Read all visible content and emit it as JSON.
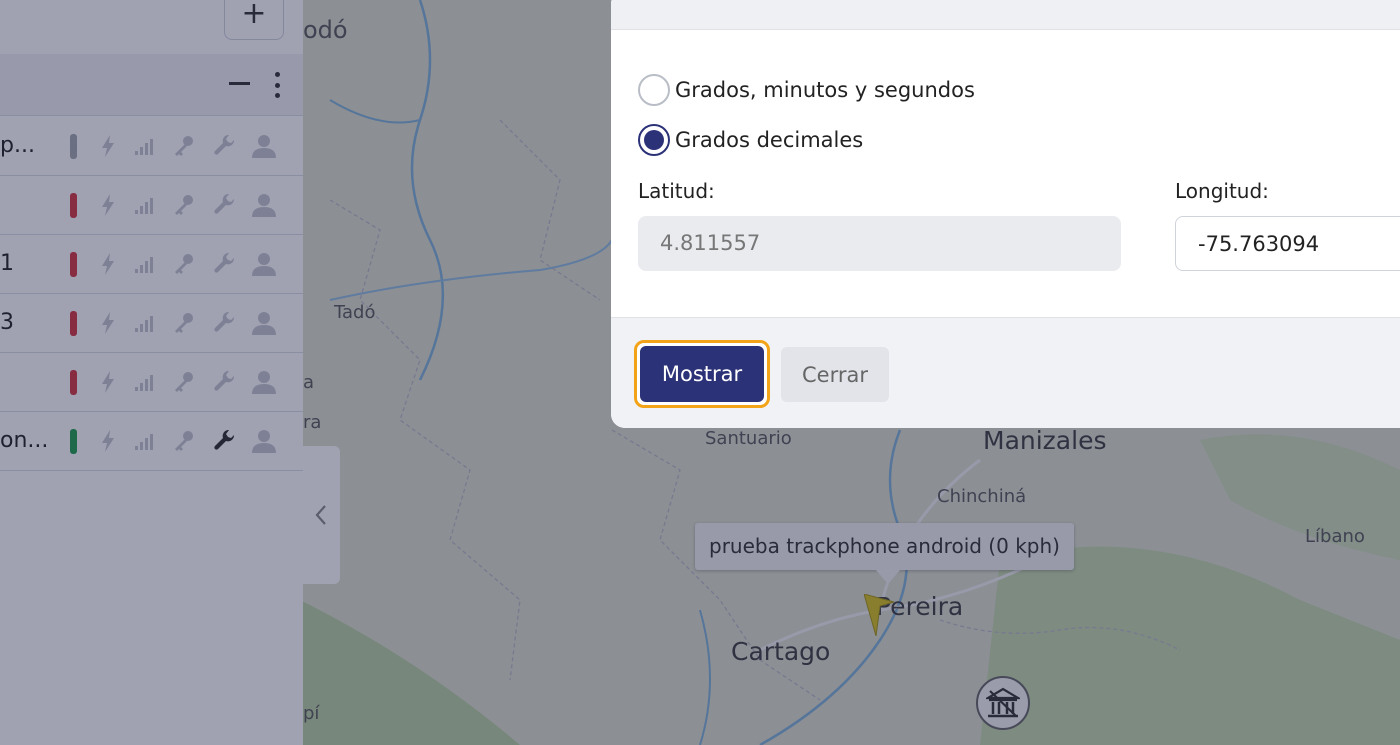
{
  "map": {
    "labels": {
      "tado_top": "odó",
      "tado": "Tadó",
      "edge_a": "a",
      "edge_ra": "ra",
      "santuario": "Santuario",
      "manizales": "Manizales",
      "chinchina": "Chinchiná",
      "libano": "Líbano",
      "pereira": "Pereira",
      "cartago": "Cartago",
      "edge_pi": "pí"
    },
    "tooltip": "prueba trackphone android (0 kph)",
    "marker_icon": "vehicle-arrow-icon",
    "poi_icon": "bank-icon"
  },
  "sidebar": {
    "add_icon": "+",
    "rows": [
      {
        "name": "p...",
        "status_color": "#a3a7ad",
        "wrench_active": false
      },
      {
        "name": "",
        "status_color": "#d6343f",
        "wrench_active": false
      },
      {
        "name": "1",
        "status_color": "#d6343f",
        "wrench_active": false
      },
      {
        "name": "3",
        "status_color": "#d6343f",
        "wrench_active": false
      },
      {
        "name": "",
        "status_color": "#d6343f",
        "wrench_active": false
      },
      {
        "name": "on...",
        "status_color": "#1f9d4a",
        "wrench_active": true
      }
    ]
  },
  "modal": {
    "radio_dms": "Grados, minutos y segundos",
    "radio_decimal": "Grados decimales",
    "selected": "decimal",
    "lat_label": "Latitud:",
    "lng_label": "Longitud:",
    "lat_value": "4.811557",
    "lng_value": "-75.763094",
    "show_button": "Mostrar",
    "close_button": "Cerrar"
  },
  "colors": {
    "primary": "#2c3277",
    "focus_ring": "#f3a317",
    "marker": "#d6c21a"
  }
}
